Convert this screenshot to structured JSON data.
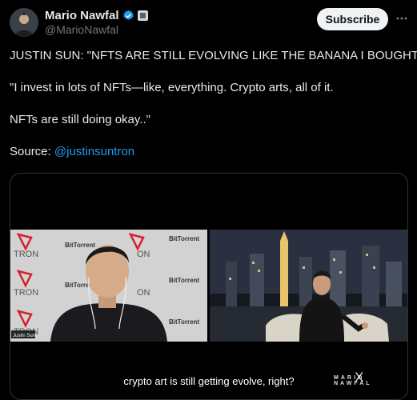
{
  "author": {
    "name": "Mario Nawfal",
    "handle": "@MarioNawfal"
  },
  "header": {
    "subscribe_label": "Subscribe",
    "more_label": "···"
  },
  "tweet": {
    "line1": "JUSTIN SUN: \"NFTS ARE STILL EVOLVING LIKE THE BANANA I BOUGHT\"",
    "line2": "\"I invest in lots of NFTs—like, everything. Crypto arts, all of it.",
    "line3": "NFTs are still doing okay..\"",
    "source_prefix": "Source: ",
    "source_mention": "@justinsuntron"
  },
  "video": {
    "caption": "crypto art is still getting evolve, right?",
    "watermark_left": "MARIO",
    "watermark_x": "X",
    "watermark_right": "NAWFAL",
    "backdrop_tron": "TRON",
    "backdrop_bittorrent": "BitTorrent",
    "backdrop_on": "ON",
    "speaker_tag": "Justin Sun"
  },
  "colors": {
    "background": "#000000",
    "text": "#e7e9ea",
    "muted": "#71767b",
    "link": "#1d9bf0",
    "verified": "#1d9bf0",
    "tron_red": "#d4202a"
  }
}
